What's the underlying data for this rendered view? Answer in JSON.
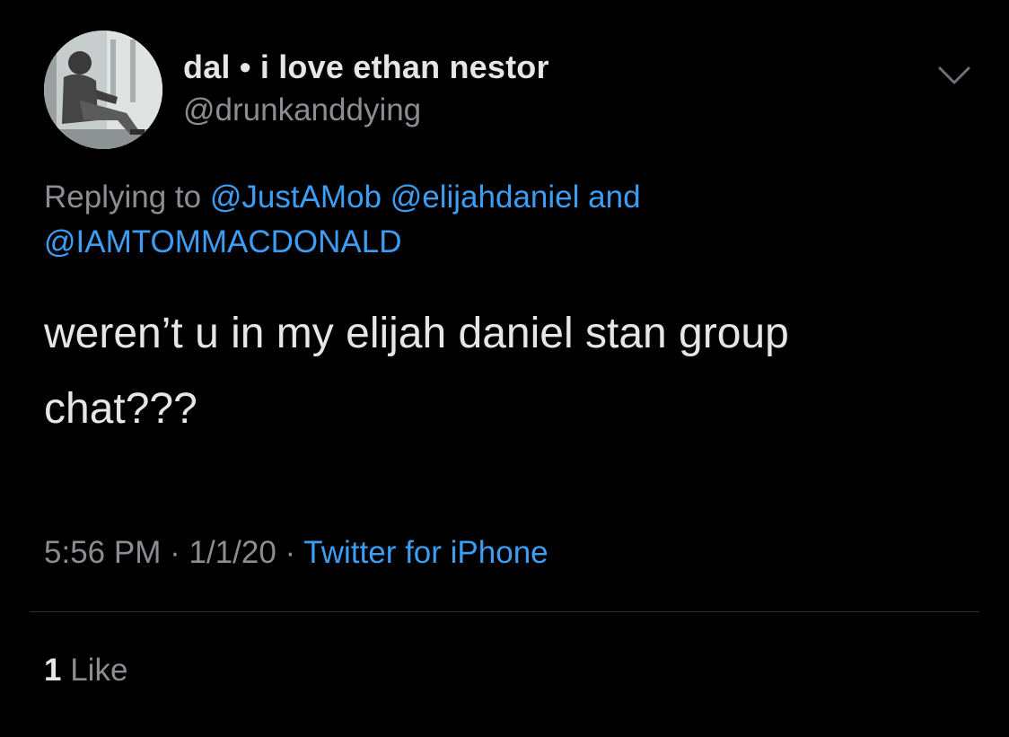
{
  "tweet": {
    "display_name": "dal • i love ethan nestor",
    "handle": "@drunkanddying",
    "reply_prefix": "Replying to",
    "reply_mentions": [
      "@JustAMob",
      "@elijahdaniel",
      "@IAMTOMMACDONALD"
    ],
    "reply_and": "and",
    "body_line1": "weren’t u in my elijah daniel stan group",
    "body_line2": "chat???",
    "time": "5:56 PM",
    "date": "1/1/20",
    "separator": "·",
    "source": "Twitter for iPhone",
    "like_count": "1",
    "like_label": "Like"
  },
  "icons": {
    "more": "chevron-down-icon",
    "avatar": "profile-photo"
  },
  "colors": {
    "background": "#000000",
    "primary_text": "#e6e6e6",
    "secondary_text": "#8a8d91",
    "link": "#3d9df2",
    "divider": "#2f3336"
  }
}
